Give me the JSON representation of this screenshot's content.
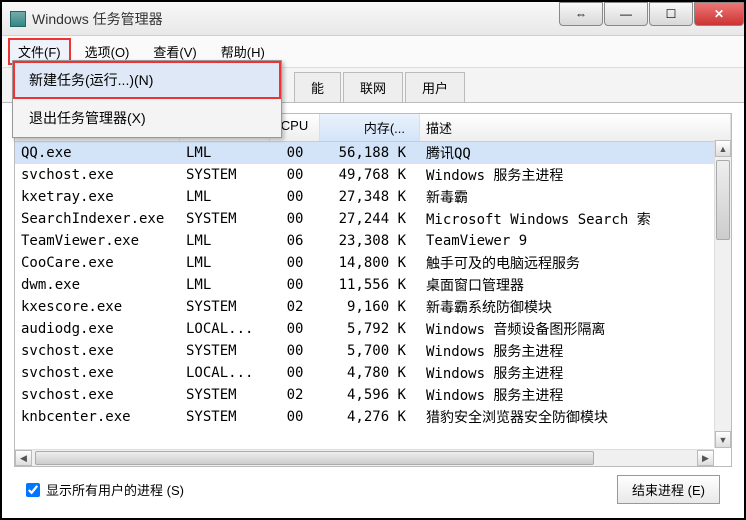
{
  "window": {
    "title": "Windows 任务管理器"
  },
  "menubar": {
    "file": "文件(F)",
    "options": "选项(O)",
    "view": "查看(V)",
    "help": "帮助(H)"
  },
  "dropdown": {
    "new_task": "新建任务(运行...)(N)",
    "exit": "退出任务管理器(X)"
  },
  "tabs": {
    "services_partial": "能",
    "networking": "联网",
    "users": "用户"
  },
  "columns": {
    "name_partial": "",
    "user_partial": "",
    "cpu": "CPU",
    "memory": "内存(...",
    "description": "描述"
  },
  "processes": [
    {
      "name": "QQ.exe",
      "user": "LML",
      "cpu": "00",
      "mem": "56,188 K",
      "desc": "腾讯QQ"
    },
    {
      "name": "svchost.exe",
      "user": "SYSTEM",
      "cpu": "00",
      "mem": "49,768 K",
      "desc": "Windows 服务主进程"
    },
    {
      "name": "kxetray.exe",
      "user": "LML",
      "cpu": "00",
      "mem": "27,348 K",
      "desc": "新毒霸"
    },
    {
      "name": "SearchIndexer.exe",
      "user": "SYSTEM",
      "cpu": "00",
      "mem": "27,244 K",
      "desc": "Microsoft Windows Search 索"
    },
    {
      "name": "TeamViewer.exe",
      "user": "LML",
      "cpu": "06",
      "mem": "23,308 K",
      "desc": "TeamViewer 9"
    },
    {
      "name": "CooCare.exe",
      "user": "LML",
      "cpu": "00",
      "mem": "14,800 K",
      "desc": "触手可及的电脑远程服务"
    },
    {
      "name": "dwm.exe",
      "user": "LML",
      "cpu": "00",
      "mem": "11,556 K",
      "desc": "桌面窗口管理器"
    },
    {
      "name": "kxescore.exe",
      "user": "SYSTEM",
      "cpu": "02",
      "mem": "9,160 K",
      "desc": "新毒霸系统防御模块"
    },
    {
      "name": "audiodg.exe",
      "user": "LOCAL...",
      "cpu": "00",
      "mem": "5,792 K",
      "desc": "Windows 音频设备图形隔离"
    },
    {
      "name": "svchost.exe",
      "user": "SYSTEM",
      "cpu": "00",
      "mem": "5,700 K",
      "desc": "Windows 服务主进程"
    },
    {
      "name": "svchost.exe",
      "user": "LOCAL...",
      "cpu": "00",
      "mem": "4,780 K",
      "desc": "Windows 服务主进程"
    },
    {
      "name": "svchost.exe",
      "user": "SYSTEM",
      "cpu": "02",
      "mem": "4,596 K",
      "desc": "Windows 服务主进程"
    },
    {
      "name": "knbcenter.exe",
      "user": "SYSTEM",
      "cpu": "00",
      "mem": "4,276 K",
      "desc": "猎豹安全浏览器安全防御模块"
    }
  ],
  "footer": {
    "show_all": "显示所有用户的进程 (S)",
    "end_process": "结束进程 (E)"
  }
}
